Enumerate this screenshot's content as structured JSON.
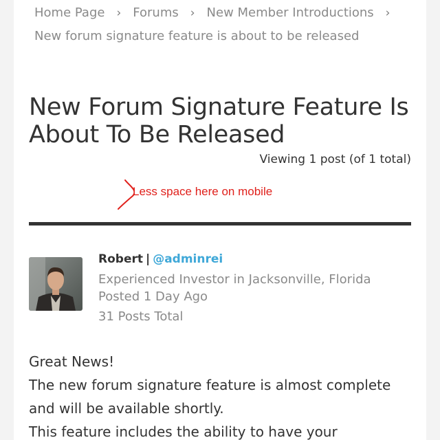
{
  "breadcrumb": {
    "items": [
      "Home Page",
      "Forums",
      "New Member Introductions"
    ],
    "current": "New forum signature feature is about to be released",
    "separator": "›"
  },
  "topic": {
    "title": "New Forum Signature Feature Is About To Be Released",
    "viewing": "Viewing 1 post (of 1 total)"
  },
  "annotation": {
    "text": "Less space here on mobile",
    "color": "#e0201b"
  },
  "post": {
    "author": {
      "name": "Robert",
      "separator": "|",
      "handle": "@adminrei",
      "role": "Experienced Investor in Jacksonville, Florida",
      "posted": "Posted 1 Day Ago",
      "posts_total": "31 Posts Total"
    },
    "body": [
      "Great News!",
      "The new forum signature feature is almost complete and will be available shortly.",
      "This feature includes the ability to have your"
    ]
  },
  "colors": {
    "link": "#3fa8d8",
    "muted": "#8a8a8a",
    "text": "#333333",
    "annotation": "#e0201b"
  }
}
